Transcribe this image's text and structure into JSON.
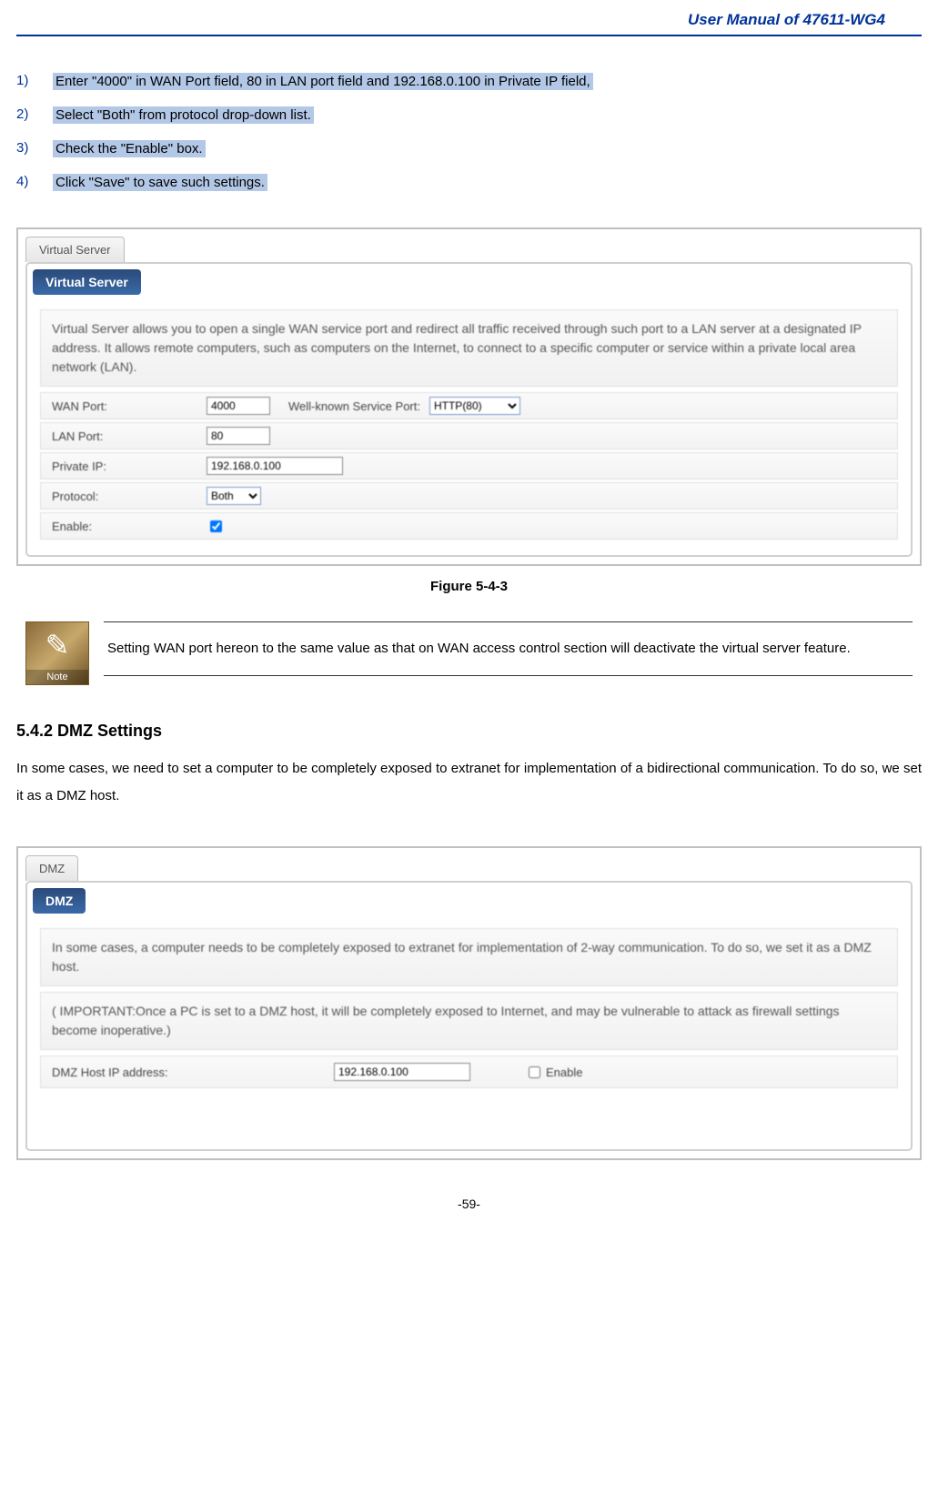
{
  "header": {
    "title": "User Manual of 47611-WG4"
  },
  "steps": [
    {
      "num": "1)",
      "text": "Enter \"4000\" in WAN Port field, 80 in LAN port field and 192.168.0.100 in Private IP field,  "
    },
    {
      "num": "2)",
      "text": "Select \"Both\" from protocol drop-down list."
    },
    {
      "num": "3)",
      "text": "Check the \"Enable\" box."
    },
    {
      "num": "4)",
      "text": "Click \"Save\" to save such settings."
    }
  ],
  "figure1": {
    "tab": "Virtual Server",
    "panel_title": "Virtual Server",
    "description": "Virtual Server allows you to open a single WAN service port and redirect all traffic received through such port to a LAN server at a designated IP address. It allows remote computers, such as computers on the Internet, to connect to a specific computer or service within a private local area network (LAN).",
    "rows": {
      "wan_port_label": "WAN Port:",
      "wan_port_value": "4000",
      "wellknown_label": "Well-known Service Port:",
      "wellknown_value": "HTTP(80)",
      "lan_port_label": "LAN Port:",
      "lan_port_value": "80",
      "private_ip_label": "Private IP:",
      "private_ip_value": "192.168.0.100",
      "protocol_label": "Protocol:",
      "protocol_value": "Both",
      "enable_label": "Enable:"
    },
    "caption": "Figure 5-4-3"
  },
  "note": {
    "icon_label": "Note",
    "text": "Setting WAN port hereon to the same value as that on WAN access control section will deactivate the virtual server feature."
  },
  "section": {
    "heading": "5.4.2  DMZ Settings",
    "paragraph": "In some cases, we need to set a computer to be completely exposed to extranet for implementation of a bidirectional communication. To do so, we set it as a DMZ host."
  },
  "figure2": {
    "tab": "DMZ",
    "panel_title": "DMZ",
    "desc1": "In some cases, a computer needs to be completely exposed to extranet for implementation of 2-way communication. To do so, we set it as a DMZ host.",
    "desc2": "( IMPORTANT:Once a PC is set to a DMZ host, it will be completely exposed to Internet, and may be vulnerable to attack as firewall settings become inoperative.)",
    "host_label": "DMZ Host IP address:",
    "host_value": "192.168.0.100",
    "enable_label": "Enable"
  },
  "page_number": "-59-"
}
